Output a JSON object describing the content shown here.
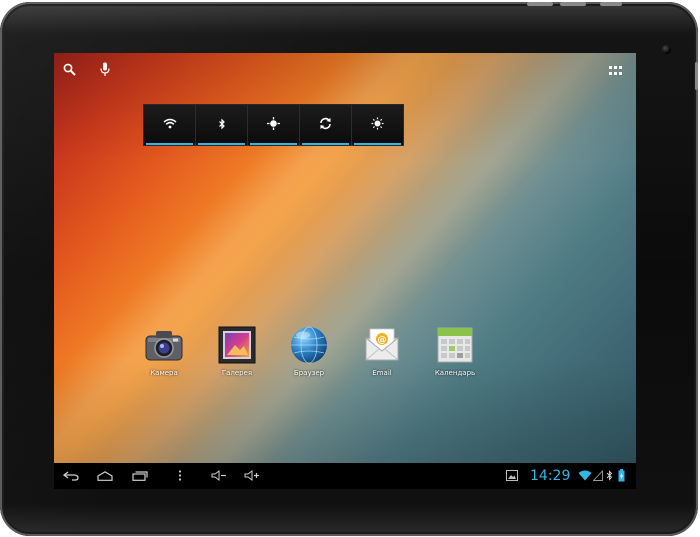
{
  "device": {
    "name": "android-tablet"
  },
  "top_bar": {
    "search_icon": "search-icon",
    "voice_icon": "microphone-icon",
    "apps_icon": "all-apps-grid-icon"
  },
  "power_widget": {
    "toggles": [
      {
        "id": "wifi",
        "icon": "wifi-icon",
        "active": true
      },
      {
        "id": "bluetooth",
        "icon": "bluetooth-icon",
        "active": true
      },
      {
        "id": "gps",
        "icon": "gps-icon",
        "active": true
      },
      {
        "id": "sync",
        "icon": "sync-icon",
        "active": true
      },
      {
        "id": "brightness",
        "icon": "brightness-icon",
        "active": true
      }
    ],
    "accent_color": "#33b5e5"
  },
  "apps": [
    {
      "id": "camera",
      "label": "Камера",
      "icon": "camera-icon"
    },
    {
      "id": "gallery",
      "label": "Галерея",
      "icon": "gallery-icon"
    },
    {
      "id": "browser",
      "label": "Браузер",
      "icon": "globe-icon"
    },
    {
      "id": "email",
      "label": "Email",
      "icon": "email-icon"
    },
    {
      "id": "calendar",
      "label": "Календарь",
      "icon": "calendar-icon"
    }
  ],
  "navigation_bar": {
    "buttons": [
      "back-icon",
      "home-icon",
      "recent-apps-icon",
      "menu-icon",
      "volume-down-icon",
      "volume-up-icon"
    ]
  },
  "status": {
    "time": "14:29",
    "icons": [
      "screenshot-notification-icon",
      "wifi-signal-icon",
      "bluetooth-icon",
      "battery-charging-icon"
    ],
    "time_color": "#33b5e5"
  }
}
